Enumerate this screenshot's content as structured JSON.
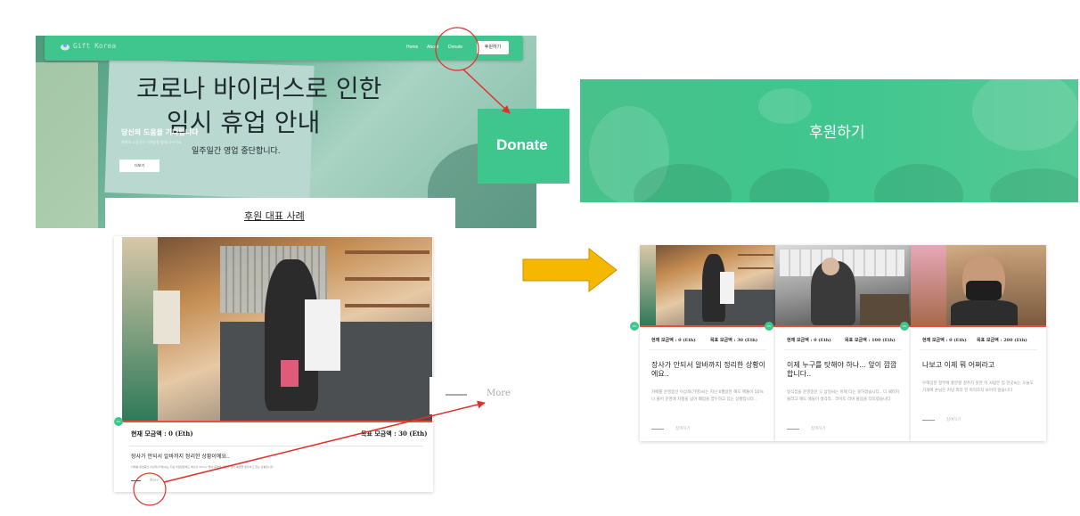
{
  "colors": {
    "brand_green": "#3fc68e",
    "progress_red": "#e74c3c",
    "annotation_red": "#e0302a",
    "arrow_yellow": "#f5b700"
  },
  "navbar": {
    "brand": "Gift Korea",
    "links": [
      "Home",
      "About",
      "Donate"
    ],
    "cta": "후원하기"
  },
  "hero": {
    "sign_line1": "코로나 바이러스로 인한",
    "sign_line2": "임시 휴업 안내",
    "sign_line3": "일주일간 영업 중단합니다.",
    "heading": "당신의 도움을 기다립니다",
    "subtext": "지역의 소상공인 어려움을 함께 나누어요",
    "button": "더보기"
  },
  "section": {
    "title": "후원 대표 사례"
  },
  "featured_card": {
    "percent": "0%",
    "current": "현재 모금액 : 0 (Eth)",
    "goal": "목표 모금액 : 30 (Eth)",
    "title": "장사가 안되서 알바까지 정리한 상황이에요..",
    "desc": "카페를 운영중인 이상희(가명)씨는 지난 6월달만해도 매출이 50%나 줄어 운영에 차질을 넘어 폐업을 염두하고 있는 상황입니다.",
    "more": "More"
  },
  "callouts": {
    "donate": "Donate",
    "more": "More"
  },
  "banner": {
    "title": "후원하기"
  },
  "cards": [
    {
      "percent": "0%",
      "current": "현재 모금액 : 0 (Eth)",
      "goal": "목표 모금액 : 30 (Eth)",
      "title": "장사가 안되서 알바까지 정리한 상황이에요..",
      "desc": "카페를 운영중인 이상희(가명)씨는 지난 6월달만 해도 매출이 50%나 줄어 운영에 차질을 넘어 폐업을 염두하고 있는 상황입니다..",
      "more": "참여하기"
    },
    {
      "percent": "0%",
      "current": "현재 모금액 : 0 (Eth)",
      "goal": "목표 모금액 : 100 (Eth)",
      "title": "이제 누구를 탓해야 하나... 앞이 깜깜합니다..",
      "desc": "일식집을 운영중인 오 삼일씨는 이제 더는 못하겠습니다.. 다 때려치울라고 해도 애들이 생각라.. 코어도 라며 울음을 터뜨렸습니다",
      "more": "참여하기"
    },
    {
      "percent": "0%",
      "current": "현재 모금액 : 0 (Eth)",
      "goal": "목표 모금액 : 200 (Eth)",
      "title": "나보고 이제 뭐 어쩌라고",
      "desc": "우해임한 정부에 홍분할 걸주지 못한 이 사람은 집 한곳씨는 오늘도 가게에 손님은 커녕 파리 한 마리조차 보이지 않습니다",
      "more": "참여하기"
    }
  ]
}
